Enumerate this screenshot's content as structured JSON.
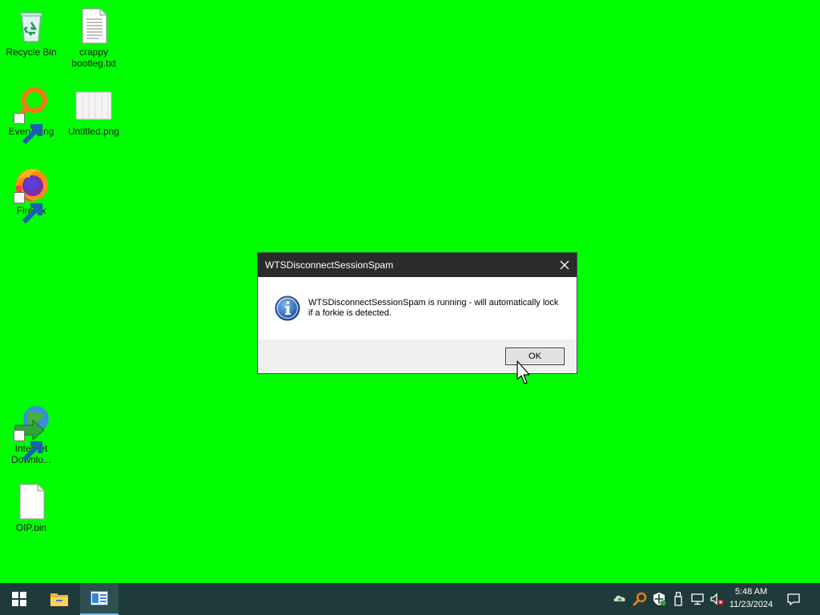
{
  "desktop": {
    "background": "#00ff00",
    "icons": [
      {
        "label": "Recycle Bin"
      },
      {
        "label": "crappy bootleg.txt"
      },
      {
        "label": "Everything"
      },
      {
        "label": "Untitled.png"
      },
      {
        "label": "Firefox"
      },
      {
        "label": "Internet Downlo..."
      },
      {
        "label": "OIP.bin"
      }
    ]
  },
  "dialog": {
    "title": "WTSDisconnectSessionSpam",
    "message": "WTSDisconnectSessionSpam is running - will automatically lock if a forkie is detected.",
    "ok_label": "OK",
    "icon": "info-icon"
  },
  "taskbar": {
    "background": "#1e3a3a",
    "items": [
      "start-icon",
      "file-explorer-icon",
      "dialog-app-icon"
    ],
    "tray": [
      "cloud-icon",
      "everything-icon",
      "defender-icon",
      "usb-icon",
      "network-icon",
      "volume-muted-icon"
    ],
    "clock": {
      "time": "5:48 AM",
      "date": "11/23/2024"
    },
    "notifications_icon": "notification-icon"
  }
}
